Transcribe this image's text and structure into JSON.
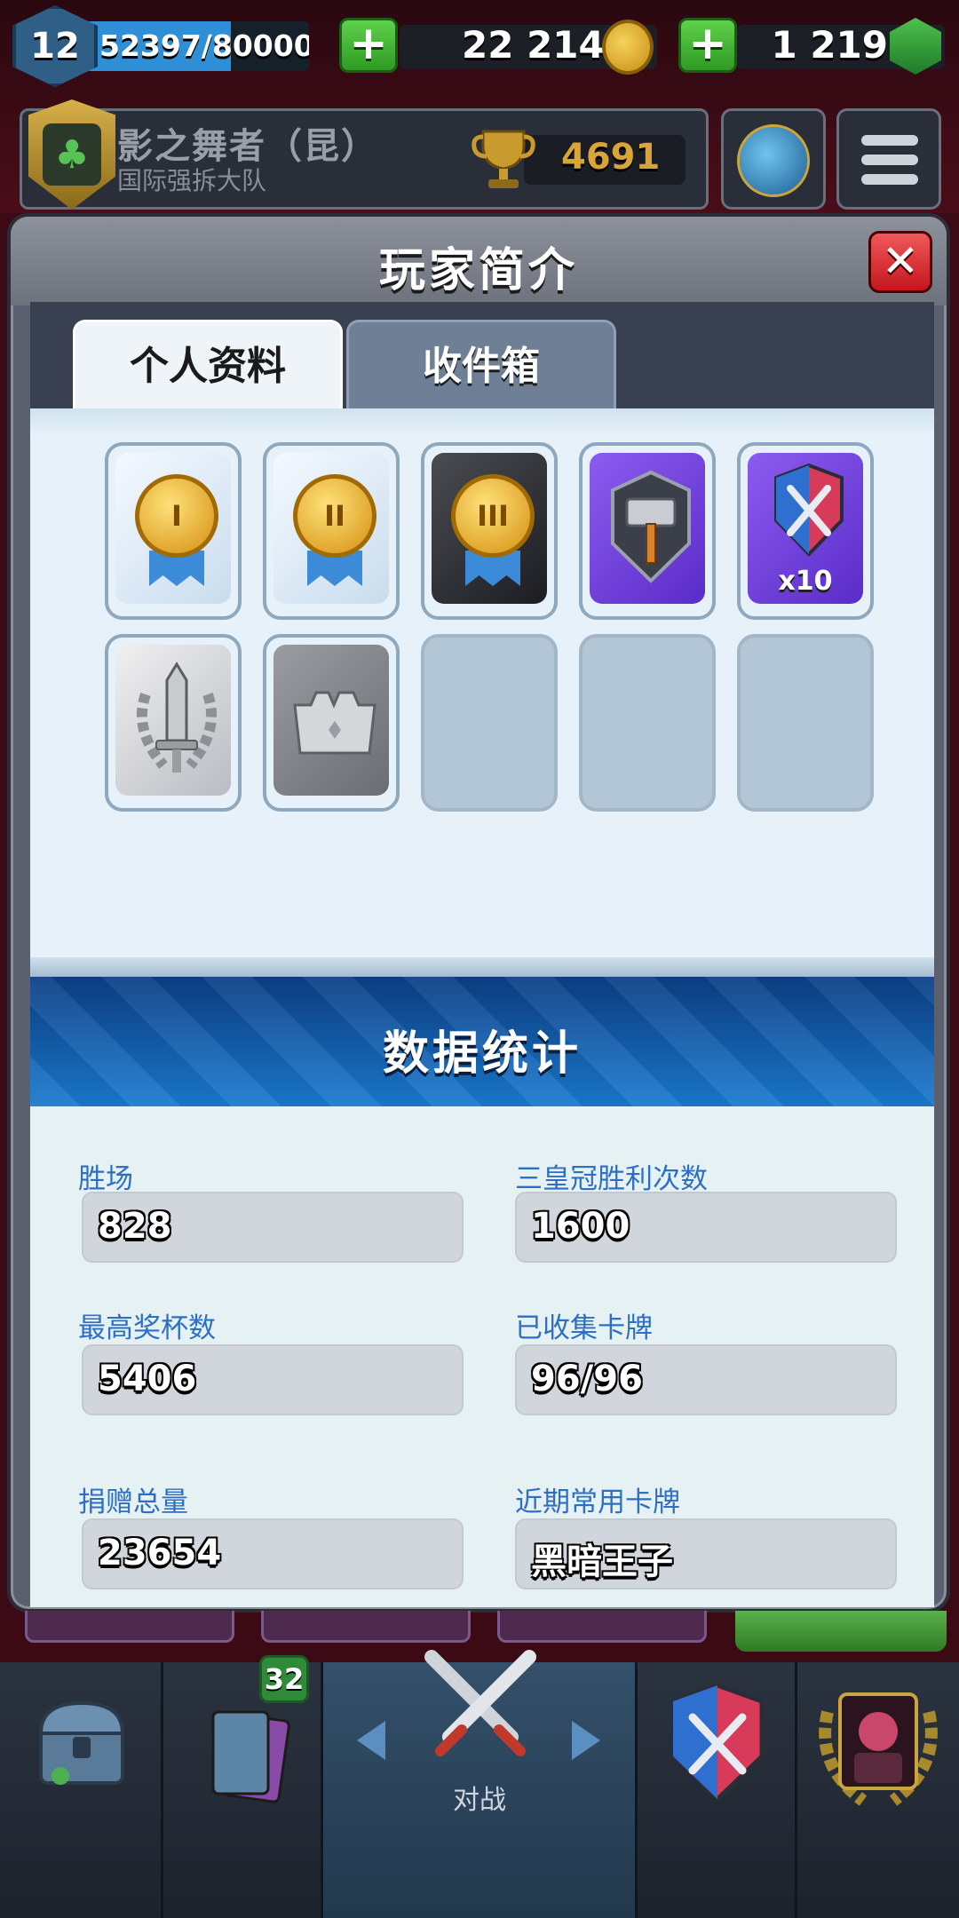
{
  "hud": {
    "level": "12",
    "xp_text": "52397/80000",
    "xp_fraction": 0.655,
    "gold": "22 214",
    "gems": "1 219",
    "plus_label": "+"
  },
  "player": {
    "name": "影之舞者（昆）",
    "clan": "国际强拆大队",
    "trophies": "4691"
  },
  "modal": {
    "title": "玩家简介",
    "close_label": "✕",
    "tabs": [
      {
        "label": "个人资料",
        "active": true
      },
      {
        "label": "收件箱",
        "active": false
      }
    ],
    "badges": {
      "medal_1": "I",
      "medal_2": "II",
      "medal_3": "III",
      "x10_label": "x10"
    },
    "stats_title": "数据统计",
    "stats": [
      {
        "label": "胜场",
        "value": "828"
      },
      {
        "label": "三皇冠胜利次数",
        "value": "1600"
      },
      {
        "label": "最高奖杯数",
        "value": "5406"
      },
      {
        "label": "已收集卡牌",
        "value": "96/96"
      },
      {
        "label": "捐赠总量",
        "value": "23654"
      },
      {
        "label": "近期常用卡牌",
        "value": "黑暗王子"
      }
    ]
  },
  "nav": {
    "card_count": "32",
    "battle_label": "对战"
  },
  "colors": {
    "accent_blue": "#2d6fc2",
    "close_red": "#c4161c",
    "plus_green": "#2e9a22",
    "trophy_gold": "#d9a536"
  }
}
